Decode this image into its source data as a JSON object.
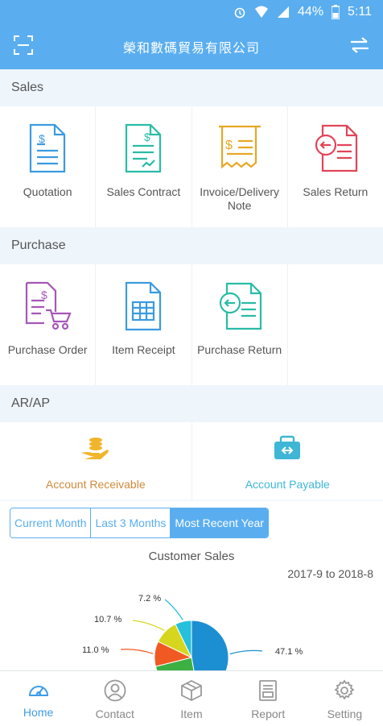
{
  "status": {
    "battery": "44%",
    "time": "5:11"
  },
  "header": {
    "title": "榮和數碼貿易有限公司"
  },
  "sales": {
    "title": "Sales",
    "items": [
      {
        "label": "Quotation"
      },
      {
        "label": "Sales Contract"
      },
      {
        "label": "Invoice/Delivery Note"
      },
      {
        "label": "Sales Return"
      }
    ]
  },
  "purchase": {
    "title": "Purchase",
    "items": [
      {
        "label": "Purchase Order"
      },
      {
        "label": "Item Receipt"
      },
      {
        "label": "Purchase Return"
      }
    ]
  },
  "arap": {
    "title": "AR/AP",
    "receivable": "Account Receivable",
    "payable": "Account Payable",
    "receivable_color": "#d08a3a",
    "payable_color": "#3fb6d6"
  },
  "period_tabs": [
    "Current Month",
    "Last 3 Months",
    "Most Recent Year"
  ],
  "active_tab": "Most Recent Year",
  "chart_data": {
    "type": "pie",
    "title": "Customer Sales",
    "subtitle": "2017-9 to 2018-8",
    "slices": [
      {
        "value": 47.1,
        "label": "47.1 %",
        "color": "#1b8fd1"
      },
      {
        "value": 11.0,
        "label": "11.0 %",
        "color": "#f05a22"
      },
      {
        "value": 10.7,
        "label": "10.7 %",
        "color": "#d6d61f"
      },
      {
        "value": 7.2,
        "label": "7.2 %",
        "color": "#26c0dc"
      }
    ]
  },
  "nav": {
    "home": "Home",
    "contact": "Contact",
    "item": "Item",
    "report": "Report",
    "setting": "Setting"
  },
  "colors": {
    "accent": "#5aaef0"
  }
}
